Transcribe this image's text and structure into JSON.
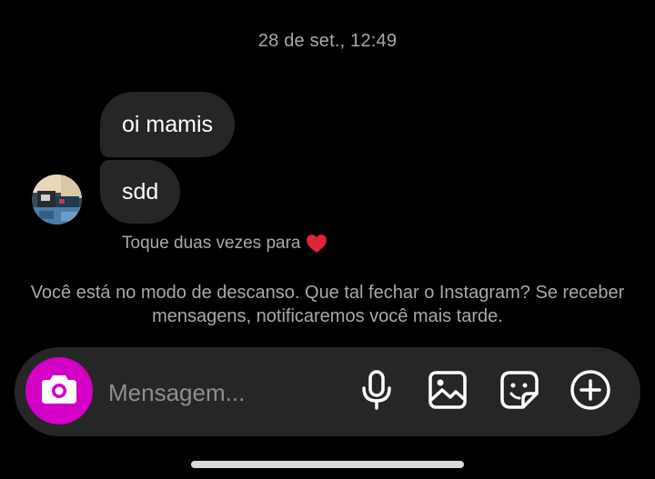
{
  "thread": {
    "timestamp": "28 de set., 12:49",
    "messages": [
      {
        "text": "oi mamis"
      },
      {
        "text": "sdd"
      }
    ],
    "reaction_hint": "Toque duas vezes para",
    "reaction_emoji": "heart-icon",
    "rest_mode_notice": "Você está no modo de descanso. Que tal fechar o Instagram? Se receber mensagens, notificaremos você mais tarde."
  },
  "composer": {
    "placeholder": "Mensagem...",
    "icons": [
      "camera-icon",
      "microphone-icon",
      "gallery-icon",
      "sticker-icon",
      "add-circle-icon"
    ]
  },
  "colors": {
    "background": "#000000",
    "bubble": "#262626",
    "muted_text": "#a8a8a8",
    "camera_accent": "#d300c5",
    "heart": "#e0243a"
  }
}
